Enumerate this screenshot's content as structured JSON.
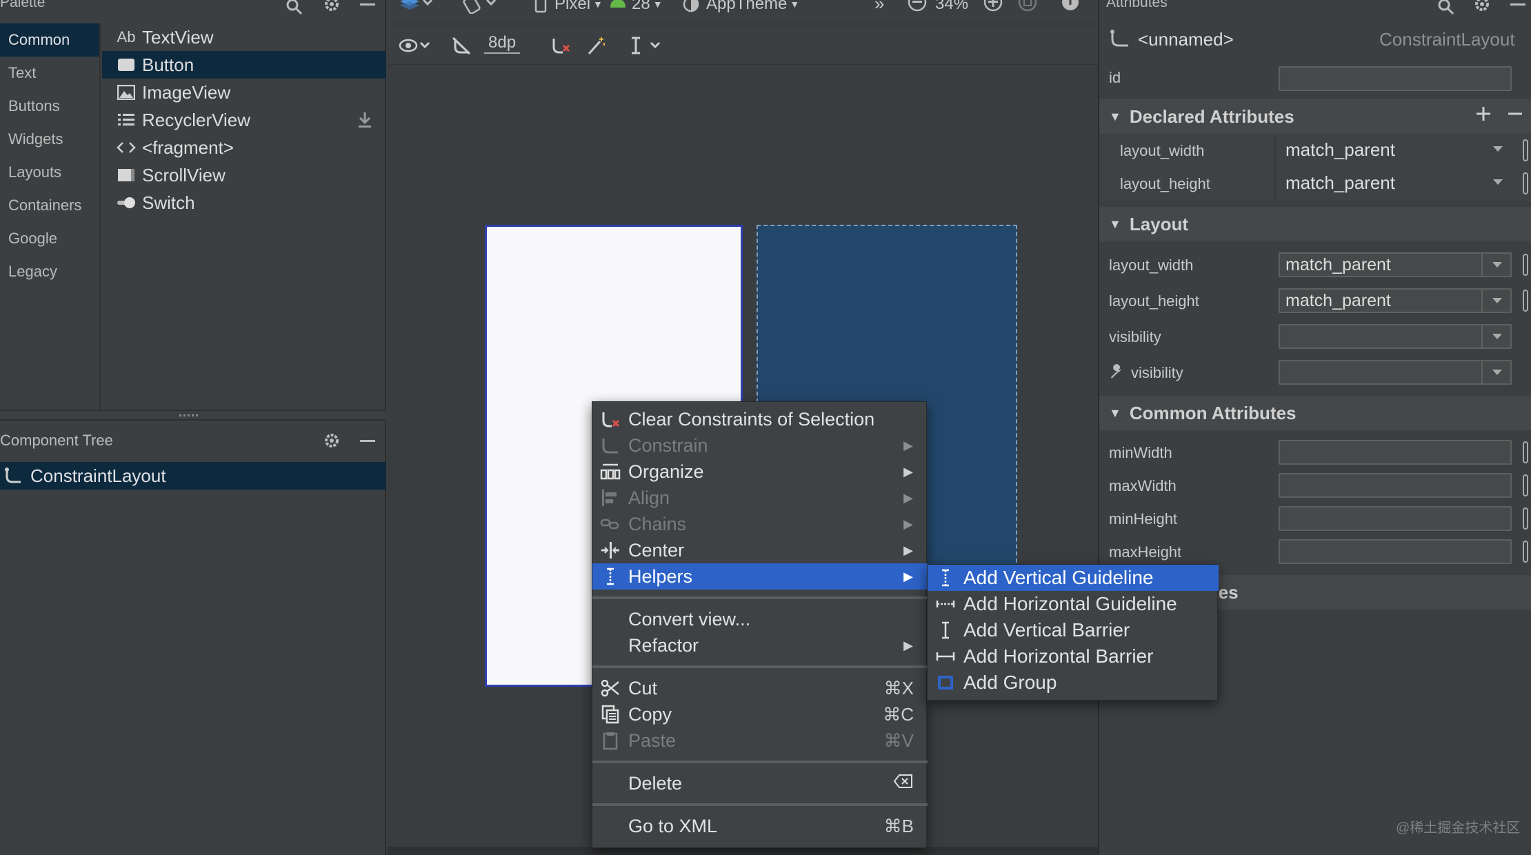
{
  "palette": {
    "title": "Palette",
    "categories": [
      "Common",
      "Text",
      "Buttons",
      "Widgets",
      "Layouts",
      "Containers",
      "Google",
      "Legacy"
    ],
    "widgets": [
      {
        "icon": "textview-icon",
        "label": "TextView"
      },
      {
        "icon": "button-icon",
        "label": "Button"
      },
      {
        "icon": "imageview-icon",
        "label": "ImageView"
      },
      {
        "icon": "recyclerview-icon",
        "label": "RecyclerView"
      },
      {
        "icon": "fragment-icon",
        "label": "<fragment>"
      },
      {
        "icon": "scrollview-icon",
        "label": "ScrollView"
      },
      {
        "icon": "switch-icon",
        "label": "Switch"
      }
    ],
    "textview_prefix": "Ab"
  },
  "component_tree": {
    "title": "Component Tree",
    "root": "ConstraintLayout"
  },
  "toolbar": {
    "device": "Pixel",
    "api": "28",
    "theme": "AppTheme",
    "zoom": "34%",
    "margin": "8dp",
    "more": "»"
  },
  "attributes": {
    "title": "Attributes",
    "component_name": "<unnamed>",
    "component_type": "ConstraintLayout",
    "id_label": "id",
    "id_value": "",
    "declared": {
      "title": "Declared Attributes",
      "rows": [
        {
          "label": "layout_width",
          "value": "match_parent"
        },
        {
          "label": "layout_height",
          "value": "match_parent"
        }
      ]
    },
    "layout": {
      "title": "Layout",
      "rows": [
        {
          "label": "layout_width",
          "value": "match_parent"
        },
        {
          "label": "layout_height",
          "value": "match_parent"
        },
        {
          "label": "visibility",
          "value": ""
        },
        {
          "label": "visibility",
          "value": ""
        }
      ]
    },
    "common": {
      "title": "Common Attributes",
      "rows": [
        {
          "label": "minWidth",
          "value": ""
        },
        {
          "label": "maxWidth",
          "value": ""
        },
        {
          "label": "minHeight",
          "value": ""
        },
        {
          "label": "maxHeight",
          "value": ""
        }
      ]
    },
    "next_section_partial": "tes"
  },
  "context_menu": {
    "items": [
      {
        "label": "Clear Constraints of Selection",
        "icon": "clear-constraints-icon",
        "submenu": false,
        "disabled": false
      },
      {
        "label": "Constrain",
        "icon": "constrain-icon",
        "submenu": true,
        "disabled": true
      },
      {
        "label": "Organize",
        "icon": "organize-icon",
        "submenu": true,
        "disabled": false
      },
      {
        "label": "Align",
        "icon": "align-icon",
        "submenu": true,
        "disabled": true
      },
      {
        "label": "Chains",
        "icon": "chains-icon",
        "submenu": true,
        "disabled": true
      },
      {
        "label": "Center",
        "icon": "center-icon",
        "submenu": true,
        "disabled": false
      },
      {
        "label": "Helpers",
        "icon": "helpers-icon",
        "submenu": true,
        "disabled": false,
        "highlighted": true
      }
    ],
    "group2": [
      {
        "label": "Convert view...",
        "submenu": false
      },
      {
        "label": "Refactor",
        "submenu": true
      }
    ],
    "group3": [
      {
        "label": "Cut",
        "shortcut": "⌘X",
        "icon": "cut-icon",
        "disabled": false
      },
      {
        "label": "Copy",
        "shortcut": "⌘C",
        "icon": "copy-icon",
        "disabled": false
      },
      {
        "label": "Paste",
        "shortcut": "⌘V",
        "icon": "paste-icon",
        "disabled": true
      }
    ],
    "delete": {
      "label": "Delete",
      "icon": "backspace-icon"
    },
    "goto_xml": {
      "label": "Go to XML",
      "shortcut": "⌘B"
    }
  },
  "helpers_submenu": {
    "items": [
      {
        "label": "Add Vertical Guideline",
        "icon": "vertical-guideline-icon",
        "highlighted": true
      },
      {
        "label": "Add Horizontal Guideline",
        "icon": "horizontal-guideline-icon"
      },
      {
        "label": "Add Vertical Barrier",
        "icon": "vertical-barrier-icon"
      },
      {
        "label": "Add Horizontal Barrier",
        "icon": "horizontal-barrier-icon"
      },
      {
        "label": "Add Group",
        "icon": "group-icon"
      }
    ]
  },
  "watermark": "@稀土掘金技术社区",
  "colors": {
    "selection": "#0d293e",
    "menu_highlight": "#2d63c8",
    "blueprint": "#23476b",
    "design_border": "#2f3fb1"
  }
}
